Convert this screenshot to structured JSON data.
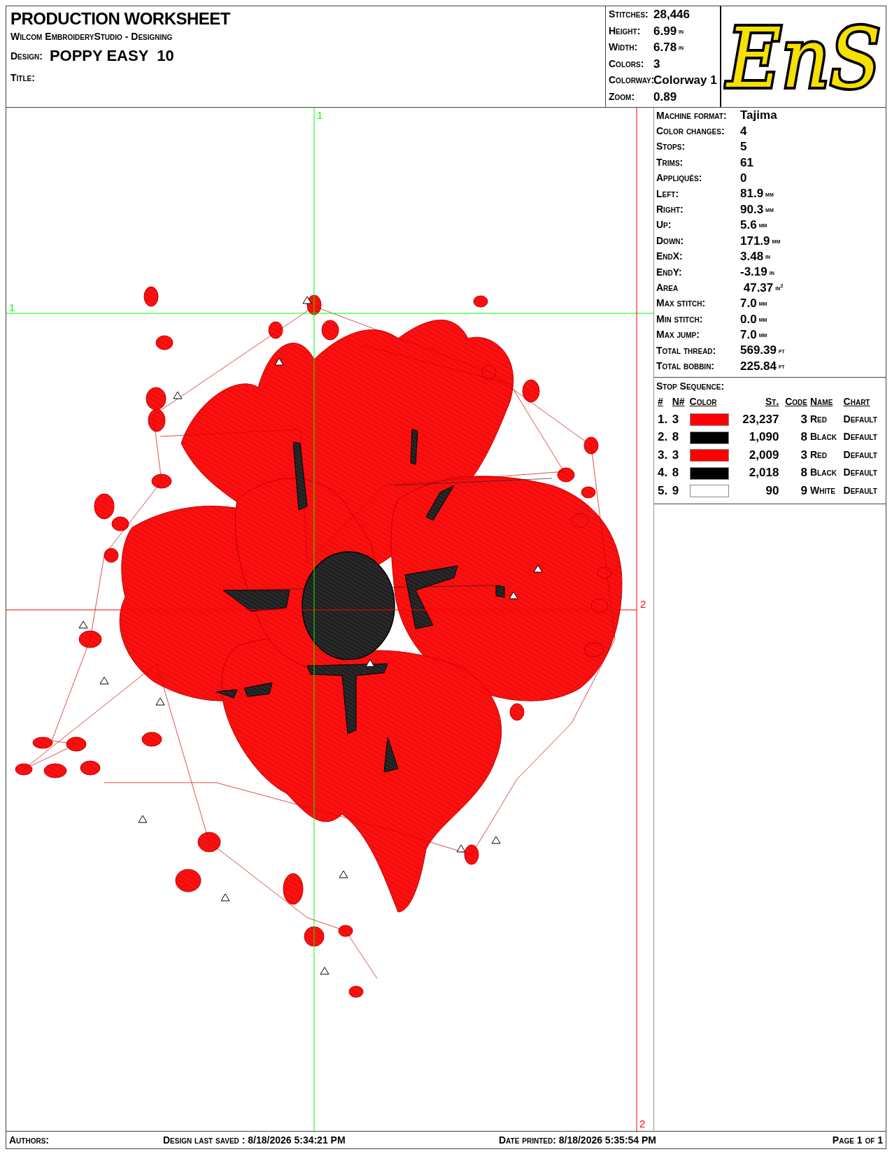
{
  "header": {
    "title": "PRODUCTION WORKSHEET",
    "subtitle": "Wilcom EmbroideryStudio - Designing",
    "design_label": "Design:",
    "design_value": "POPPY EASY  10",
    "title_label": "Title:"
  },
  "summary": [
    {
      "label": "Stitches:",
      "value": "28,446"
    },
    {
      "label": "Height:",
      "value": "6.99",
      "unit": "in"
    },
    {
      "label": "Width:",
      "value": "6.78",
      "unit": "in"
    },
    {
      "label": "Colors:",
      "value": "3"
    },
    {
      "label": "Colorway:",
      "value": "Colorway 1"
    },
    {
      "label": "Zoom:",
      "value": "0.89"
    }
  ],
  "logo": {
    "text": "EnS"
  },
  "guides": [
    {
      "label": "1",
      "kind": "vertical",
      "color": "#00ff00"
    },
    {
      "label": "1",
      "kind": "horizontal",
      "color": "#00ff00"
    },
    {
      "label": "2",
      "kind": "horizontal",
      "color": "#ff0000"
    },
    {
      "label": "2",
      "kind": "vertical",
      "color": "#ff0000"
    }
  ],
  "details": [
    {
      "label": "Machine format:",
      "value": "Tajima"
    },
    {
      "label": "Color changes:",
      "value": "4"
    },
    {
      "label": "Stops:",
      "value": "5"
    },
    {
      "label": "Trims:",
      "value": "61"
    },
    {
      "label": "Appliqués:",
      "value": "0"
    },
    {
      "label": "Left:",
      "value": "81.9",
      "unit": "mm"
    },
    {
      "label": "Right:",
      "value": "90.3",
      "unit": "mm"
    },
    {
      "label": "Up:",
      "value": "5.6",
      "unit": "mm"
    },
    {
      "label": "Down:",
      "value": "171.9",
      "unit": "mm"
    },
    {
      "label": "EndX:",
      "value": "3.48",
      "unit": "in"
    },
    {
      "label": "EndY:",
      "value": "-3.19",
      "unit": "in"
    },
    {
      "label": "Area",
      "value": " 47.37",
      "unit": "in$^{2}$"
    },
    {
      "label": "Max stitch:",
      "value": "7.0",
      "unit": "mm"
    },
    {
      "label": "Min stitch:",
      "value": "0.0",
      "unit": "mm"
    },
    {
      "label": "Max jump:",
      "value": "7.0",
      "unit": "mm"
    },
    {
      "label": "Total thread:",
      "value": "569.39",
      "unit": "ft"
    },
    {
      "label": "Total bobbin:",
      "value": "225.84",
      "unit": "ft"
    }
  ],
  "stop_sequence": {
    "title": "Stop Sequence:",
    "columns": [
      "#",
      "N#",
      "Color",
      "St.",
      "Code",
      "Name",
      "Chart"
    ],
    "rows": [
      {
        "index": "1.",
        "needle": "3",
        "color": "#ff0000",
        "stitches": "23,237",
        "code": "3",
        "name": "Red",
        "chart": "Default"
      },
      {
        "index": "2.",
        "needle": "8",
        "color": "#000000",
        "stitches": "1,090",
        "code": "8",
        "name": "Black",
        "chart": "Default"
      },
      {
        "index": "3.",
        "needle": "3",
        "color": "#ff0000",
        "stitches": "2,009",
        "code": "3",
        "name": "Red",
        "chart": "Default"
      },
      {
        "index": "4.",
        "needle": "8",
        "color": "#000000",
        "stitches": "2,018",
        "code": "8",
        "name": "Black",
        "chart": "Default"
      },
      {
        "index": "5.",
        "needle": "9",
        "color": "#ffffff",
        "stitches": "90",
        "code": "9",
        "name": "White",
        "chart": "Default"
      }
    ]
  },
  "footer": {
    "authors": "Authors:",
    "last_saved": "Design last saved : 8/18/2026 5:34:21 PM",
    "printed": "Date printed: 8/18/2026 5:35:54 PM",
    "page": "Page 1 of 1"
  }
}
